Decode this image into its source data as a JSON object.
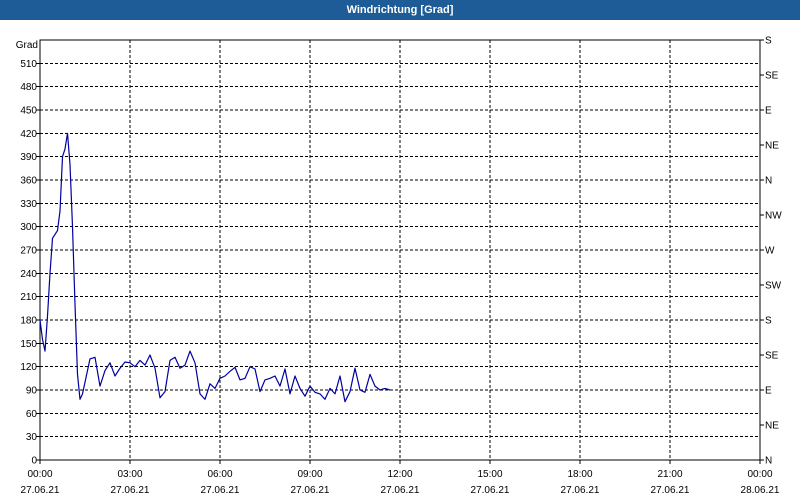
{
  "window": {
    "title": "Windrichtung [Grad]"
  },
  "chart_data": {
    "type": "line",
    "title": "Windrichtung [Grad]",
    "ylabel": "Grad",
    "xlabel": "",
    "x_range": [
      "27.06.21 00:00",
      "28.06.21 00:00"
    ],
    "ylim": [
      0,
      540
    ],
    "grid": true,
    "line_color": "#0000a0",
    "x_ticks": [
      {
        "time": "00:00",
        "date": "27.06.21"
      },
      {
        "time": "03:00",
        "date": "27.06.21"
      },
      {
        "time": "06:00",
        "date": "27.06.21"
      },
      {
        "time": "09:00",
        "date": "27.06.21"
      },
      {
        "time": "12:00",
        "date": "27.06.21"
      },
      {
        "time": "15:00",
        "date": "27.06.21"
      },
      {
        "time": "18:00",
        "date": "27.06.21"
      },
      {
        "time": "21:00",
        "date": "27.06.21"
      },
      {
        "time": "00:00",
        "date": "28.06.21"
      }
    ],
    "y_ticks": [
      0,
      30,
      60,
      90,
      120,
      150,
      180,
      210,
      240,
      270,
      300,
      330,
      360,
      390,
      420,
      450,
      480,
      510
    ],
    "y2_ticks": [
      {
        "value": 0,
        "label": "N"
      },
      {
        "value": 45,
        "label": "NE"
      },
      {
        "value": 90,
        "label": "E"
      },
      {
        "value": 135,
        "label": "SE"
      },
      {
        "value": 180,
        "label": "S"
      },
      {
        "value": 225,
        "label": "SW"
      },
      {
        "value": 270,
        "label": "W"
      },
      {
        "value": 315,
        "label": "NW"
      },
      {
        "value": 360,
        "label": "N"
      },
      {
        "value": 405,
        "label": "NE"
      },
      {
        "value": 450,
        "label": "E"
      },
      {
        "value": 495,
        "label": "SE"
      },
      {
        "value": 540,
        "label": "S"
      }
    ],
    "series": [
      {
        "x": [
          "00:00",
          "00:05",
          "00:10",
          "00:15",
          "00:20",
          "00:25",
          "00:30",
          "00:35",
          "00:40",
          "00:45",
          "00:50",
          "00:55",
          "01:00",
          "01:05",
          "01:10",
          "01:15",
          "01:20",
          "01:25",
          "01:30",
          "01:40",
          "01:50",
          "02:00",
          "02:10",
          "02:20",
          "02:30",
          "02:40",
          "02:50",
          "03:00",
          "03:10",
          "03:20",
          "03:30",
          "03:40",
          "03:50",
          "04:00",
          "04:10",
          "04:20",
          "04:30",
          "04:40",
          "04:50",
          "05:00",
          "05:10",
          "05:20",
          "05:30",
          "05:40",
          "05:50",
          "06:00",
          "06:10",
          "06:20",
          "06:30",
          "06:40",
          "06:50",
          "07:00",
          "07:10",
          "07:20",
          "07:30",
          "07:40",
          "07:50",
          "08:00",
          "08:10",
          "08:20",
          "08:30",
          "08:40",
          "08:50",
          "09:00",
          "09:10",
          "09:20",
          "09:30",
          "09:40",
          "09:50",
          "10:00",
          "10:10",
          "10:20",
          "10:30",
          "10:40",
          "10:50",
          "11:00",
          "11:10",
          "11:20",
          "11:30",
          "11:40"
        ],
        "values": [
          180,
          155,
          140,
          185,
          240,
          285,
          290,
          295,
          320,
          390,
          400,
          420,
          380,
          300,
          200,
          110,
          78,
          85,
          100,
          130,
          132,
          95,
          115,
          125,
          108,
          118,
          126,
          125,
          120,
          128,
          122,
          135,
          118,
          80,
          88,
          128,
          132,
          118,
          122,
          140,
          125,
          85,
          78,
          98,
          92,
          105,
          108,
          114,
          119,
          103,
          105,
          120,
          117,
          88,
          103,
          105,
          108,
          95,
          117,
          85,
          108,
          92,
          82,
          95,
          87,
          85,
          78,
          92,
          85,
          108,
          75,
          88,
          118,
          90,
          87,
          110,
          95,
          90,
          92,
          90
        ]
      }
    ]
  }
}
